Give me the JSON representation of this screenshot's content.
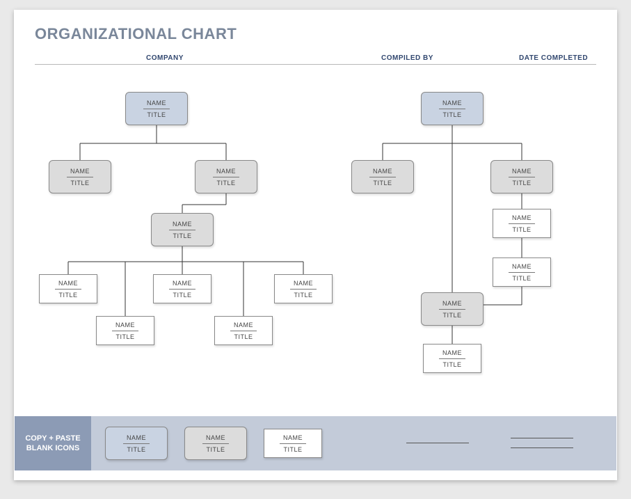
{
  "title": "ORGANIZATIONAL CHART",
  "headers": {
    "company": "COMPANY",
    "compiled": "COMPILED BY",
    "date": "DATE COMPLETED"
  },
  "box": {
    "name": "NAME",
    "title": "TITLE"
  },
  "footer": {
    "label_a": "COPY + PASTE",
    "label_b": "BLANK ICONS"
  }
}
